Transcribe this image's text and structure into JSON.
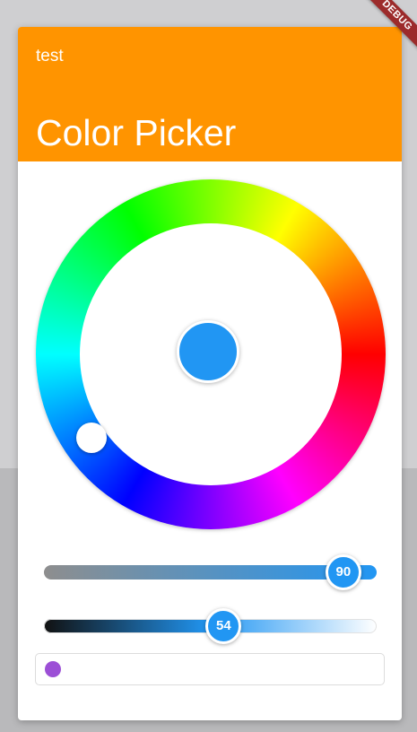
{
  "app": {
    "debug_banner": "DEBUG"
  },
  "dialog": {
    "subtitle": "test",
    "title": "Color Picker",
    "header_color": "#ff9400"
  },
  "picker": {
    "selected_color": "#2196f3",
    "saturation": {
      "value": "90",
      "fraction": 0.9
    },
    "brightness": {
      "value": "54",
      "fraction": 0.54
    },
    "color_field": {
      "swatch_color": "#9c4fd6",
      "text": ""
    }
  },
  "icons": {
    "hue_handle": "circle-handle",
    "swatch": "color-dot"
  }
}
